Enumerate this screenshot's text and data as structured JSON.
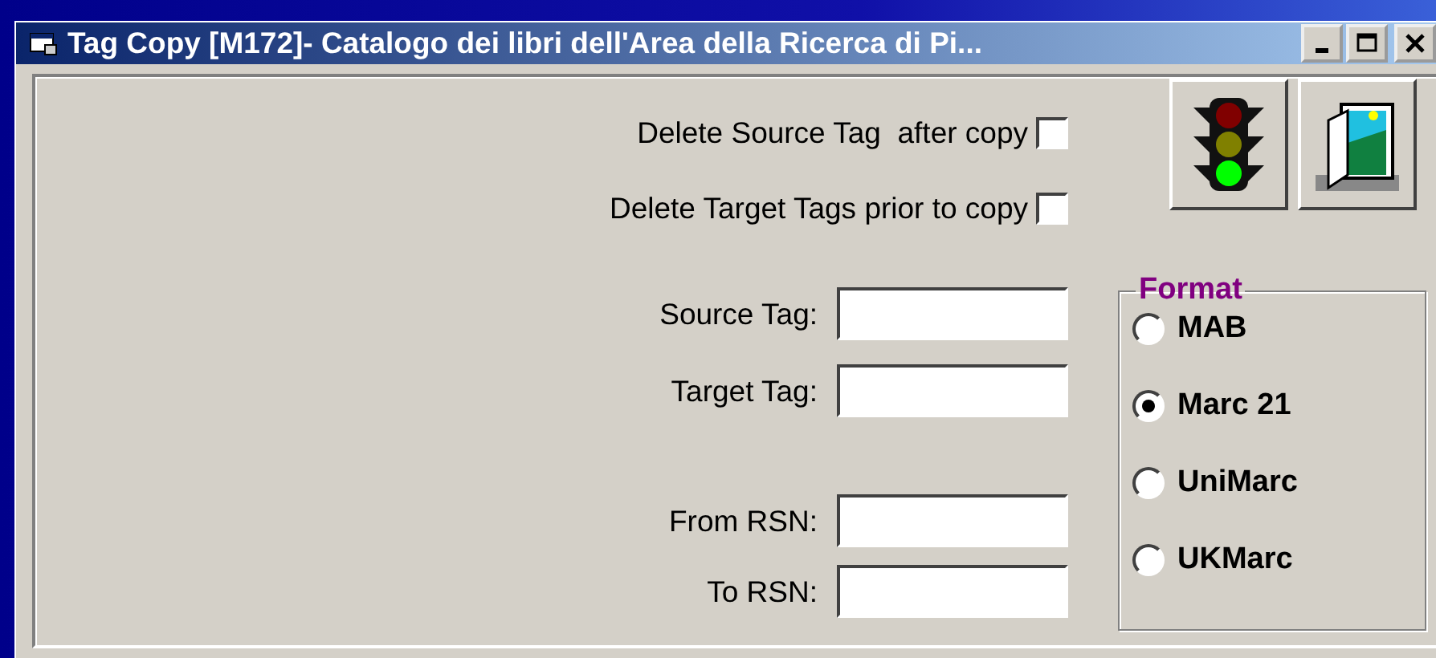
{
  "window": {
    "title": "Tag Copy [M172]- Catalogo dei libri dell'Area della Ricerca di Pi..."
  },
  "options": [
    {
      "label": "Delete Source Tag  after copy",
      "checked": false
    },
    {
      "label": "Delete Target Tags prior to copy",
      "checked": false
    }
  ],
  "tag_fields": [
    {
      "label": "Source Tag:"
    },
    {
      "label": "Target Tag:"
    }
  ],
  "rsn_fields": [
    {
      "label": "From RSN:"
    },
    {
      "label": "To RSN:"
    }
  ],
  "format": {
    "title": "Format",
    "options": [
      {
        "label": "MAB",
        "selected": false
      },
      {
        "label": "Marc 21",
        "selected": true
      },
      {
        "label": "UniMarc",
        "selected": false
      },
      {
        "label": "UKMarc",
        "selected": false
      }
    ]
  }
}
